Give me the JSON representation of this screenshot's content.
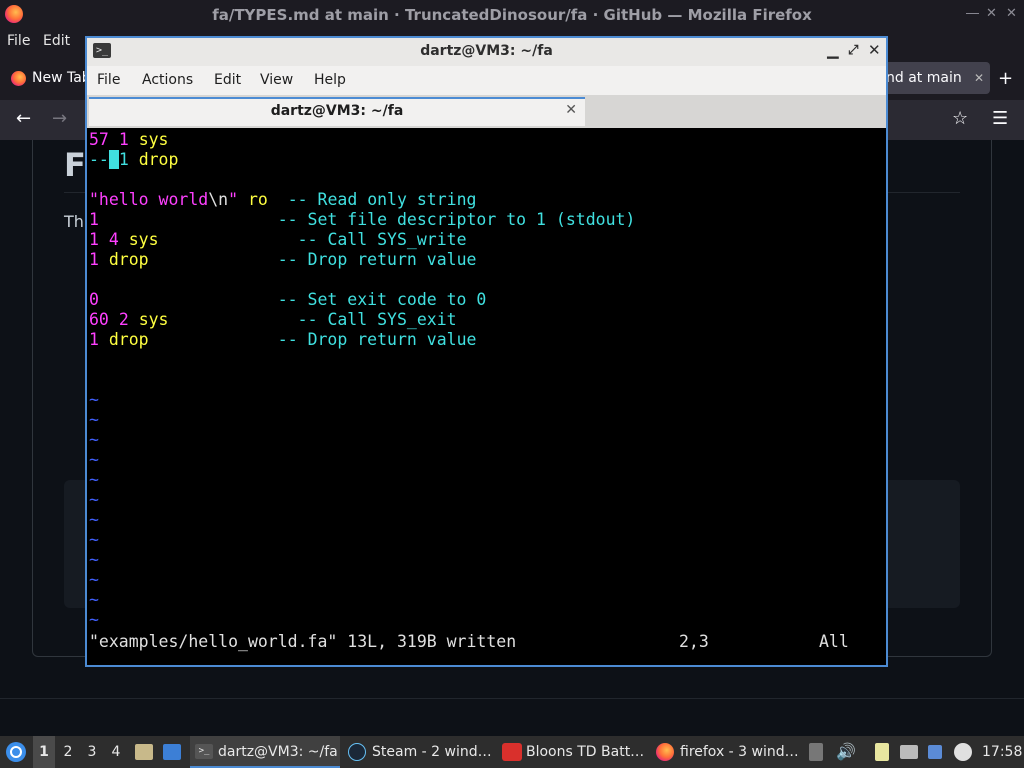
{
  "firefox": {
    "window_title": "fa/TYPES.md at main · TruncatedDinosour/fa · GitHub — Mozilla Firefox",
    "menu": [
      "File",
      "Edit"
    ],
    "tabs": {
      "new_tab": "New Tab",
      "active_partial": "nd at main"
    },
    "page": {
      "heading_partial": "F",
      "para_partial": "Th"
    }
  },
  "terminal": {
    "title": "dartz@VM3: ~/fa",
    "menu": [
      "File",
      "Actions",
      "Edit",
      "View",
      "Help"
    ],
    "tab_label": "dartz@VM3: ~/fa",
    "lines": [
      {
        "num": "57",
        "arg": "1",
        "word": "sys",
        "comment": ""
      },
      {
        "prefix": "--",
        "cursor": " ",
        "arg": "1",
        "word": "drop"
      },
      {
        "str_open": "\"hello world",
        "escape": "\\n",
        "str_close": "\"",
        "word": "ro",
        "comment": "-- Read only string"
      },
      {
        "num": "1",
        "comment": "-- Set file descriptor to 1 (stdout)"
      },
      {
        "num": "1",
        "arg": "4",
        "word": "sys",
        "comment": "-- Call SYS_write"
      },
      {
        "num": "1",
        "word": "drop",
        "comment": "-- Drop return value"
      },
      {
        "num": "0",
        "comment": "-- Set exit code to 0"
      },
      {
        "num": "60",
        "arg": "2",
        "word": "sys",
        "comment": "-- Call SYS_exit"
      },
      {
        "num": "1",
        "word": "drop",
        "comment": "-- Drop return value"
      }
    ],
    "tilde": "~",
    "status": "\"examples/hello_world.fa\" 13L, 319B written",
    "position": "2,3",
    "scroll": "All"
  },
  "taskbar": {
    "workspaces": [
      "1",
      "2",
      "3",
      "4"
    ],
    "windows": [
      "dartz@VM3: ~/fa",
      "Steam - 2 wind…",
      "Bloons TD Batt…",
      "firefox - 3 wind…"
    ],
    "clock": "17:58"
  },
  "colors": {
    "accent": "#4c8bd3",
    "vim_magenta": "#ff40ff",
    "vim_yellow": "#ffff40",
    "vim_cyan": "#40e0e0"
  }
}
